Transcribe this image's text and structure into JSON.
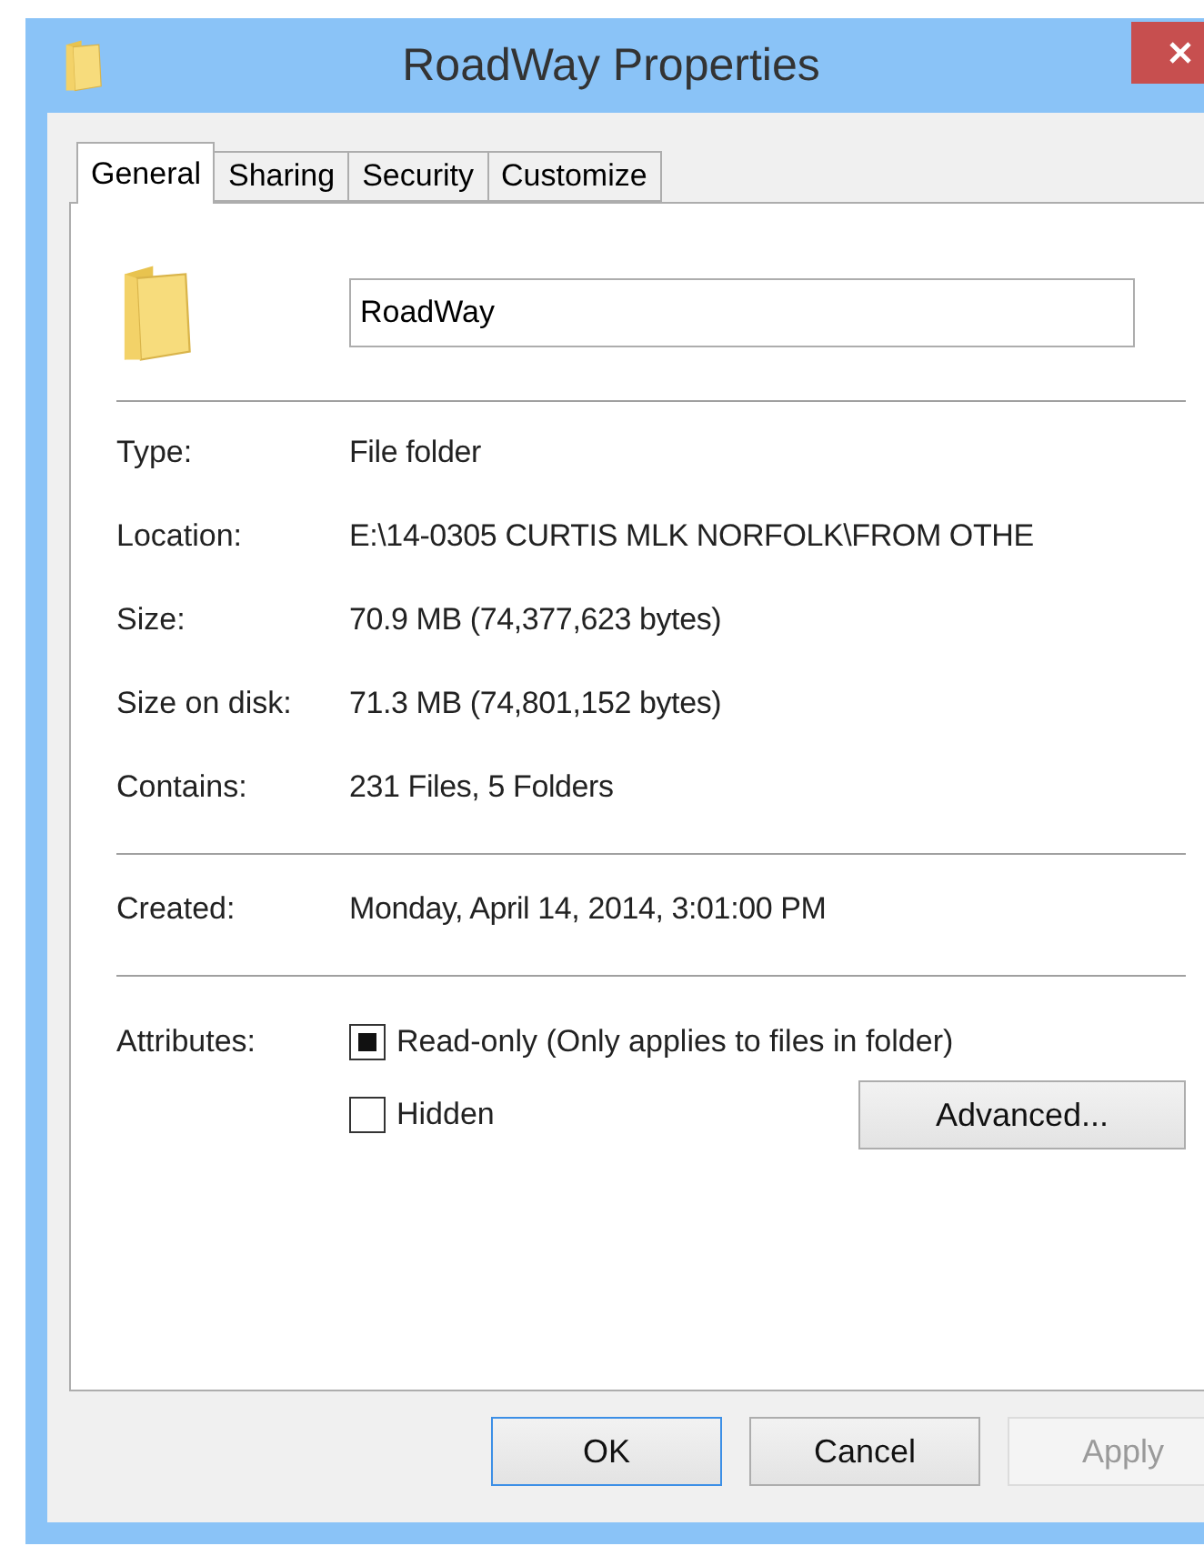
{
  "window": {
    "title": "RoadWay Properties"
  },
  "tabs": [
    {
      "label": "General",
      "selected": true
    },
    {
      "label": "Sharing",
      "selected": false
    },
    {
      "label": "Security",
      "selected": false
    },
    {
      "label": "Customize",
      "selected": false
    }
  ],
  "name_field": {
    "value": "RoadWay"
  },
  "info_groups": [
    [
      {
        "label": "Type:",
        "value": "File folder"
      },
      {
        "label": "Location:",
        "value": "E:\\14-0305 CURTIS MLK NORFOLK\\FROM OTHE"
      },
      {
        "label": "Size:",
        "value": "70.9 MB (74,377,623 bytes)"
      },
      {
        "label": "Size on disk:",
        "value": "71.3 MB (74,801,152 bytes)"
      },
      {
        "label": "Contains:",
        "value": "231 Files, 5 Folders"
      }
    ],
    [
      {
        "label": "Created:",
        "value": "Monday, April 14, 2014, 3:01:00 PM"
      }
    ]
  ],
  "attributes": {
    "label": "Attributes:",
    "options": [
      {
        "label": "Read-only (Only applies to files in folder)",
        "mixed": true
      },
      {
        "label": "Hidden",
        "mixed": false
      }
    ],
    "advanced_button": "Advanced..."
  },
  "buttons": [
    {
      "label": "OK",
      "kind": "default"
    },
    {
      "label": "Cancel",
      "kind": "normal"
    },
    {
      "label": "Apply",
      "kind": "disabled"
    }
  ]
}
